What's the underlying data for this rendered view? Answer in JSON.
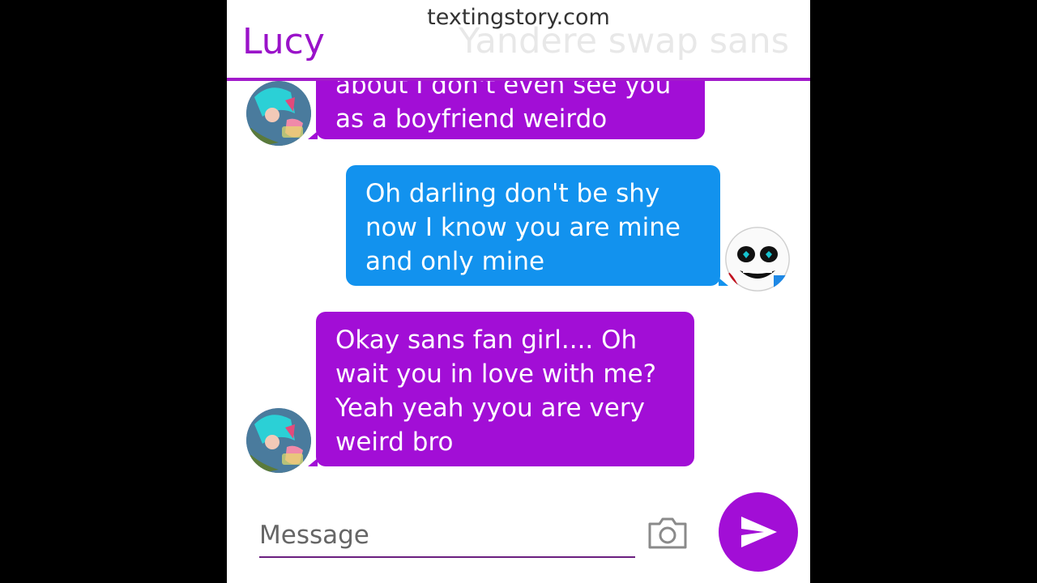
{
  "watermark": "textingstory.com",
  "header": {
    "contact_name": "Lucy",
    "other_name": "Yandere swap sans"
  },
  "messages": [
    {
      "side": "left",
      "sender": "Lucy",
      "text": "about I don't even see you\nas a boyfriend weirdo"
    },
    {
      "side": "right",
      "sender": "Yandere swap sans",
      "text": "Oh darling don't be shy\nnow I know you are mine\nand only mine"
    },
    {
      "side": "left",
      "sender": "Lucy",
      "text": "Okay sans fan girl.... Oh\nwait you in love with me?\nYeah yeah yyou are very\nweird bro"
    }
  ],
  "composer": {
    "placeholder": "Message"
  },
  "icons": {
    "camera": "camera-icon",
    "send": "send-icon"
  },
  "colors": {
    "accent": "#a20ed6",
    "outgoing": "#1292ee",
    "header_line": "#a21acb"
  }
}
